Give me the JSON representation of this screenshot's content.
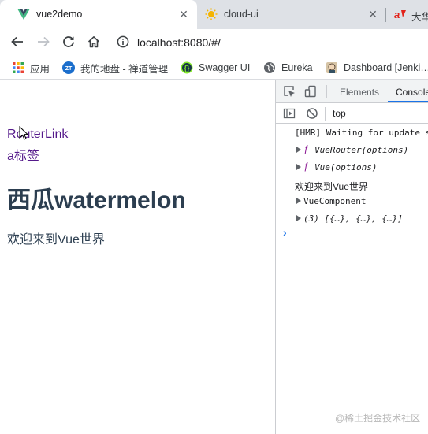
{
  "browser": {
    "tabs": [
      {
        "title": "vue2demo",
        "icon": "vue-logo-icon",
        "active": true
      },
      {
        "title": "cloud-ui",
        "icon": "sun-icon",
        "active": false
      },
      {
        "title": "大华",
        "icon": "dahua-logo-icon",
        "active": false
      }
    ],
    "close_glyph": "✕",
    "url": "localhost:8080/#/",
    "bookmarks": [
      {
        "label": "应用",
        "icon": "apps-grid-icon"
      },
      {
        "label": "我的地盘 - 禅道管理",
        "icon": "zentao-icon"
      },
      {
        "label": "Swagger UI",
        "icon": "swagger-icon"
      },
      {
        "label": "Eureka",
        "icon": "globe-icon"
      },
      {
        "label": "Dashboard [Jenki…",
        "icon": "jenkins-icon"
      }
    ]
  },
  "page": {
    "links": [
      "RouterLink",
      "a标签"
    ],
    "heading": "西瓜watermelon",
    "paragraph": "欢迎来到Vue世界"
  },
  "devtools": {
    "tabs": [
      "Elements",
      "Console"
    ],
    "active_tab": "Console",
    "context": "top",
    "console_lines": [
      {
        "text": "[HMR] Waiting for update s",
        "kind": "mono"
      },
      {
        "prefix": "ƒ",
        "text": "VueRouter(options)",
        "kind": "fn"
      },
      {
        "prefix": "ƒ",
        "text": "Vue(options)",
        "kind": "fn"
      },
      {
        "text": "欢迎来到Vue世界",
        "kind": "plain"
      },
      {
        "text": "VueComponent",
        "kind": "object"
      },
      {
        "text": "(3) [{…}, {…}, {…}]",
        "kind": "array"
      }
    ],
    "prompt_glyph": "›"
  },
  "watermark": "@稀土掘金技术社区",
  "colors": {
    "tab_strip": "#dee1e6",
    "link_visited": "#551a8b",
    "heading": "#2c3e50",
    "devtools_accent": "#1a73e8",
    "vue_green": "#41b883",
    "function_purple": "#881391"
  }
}
